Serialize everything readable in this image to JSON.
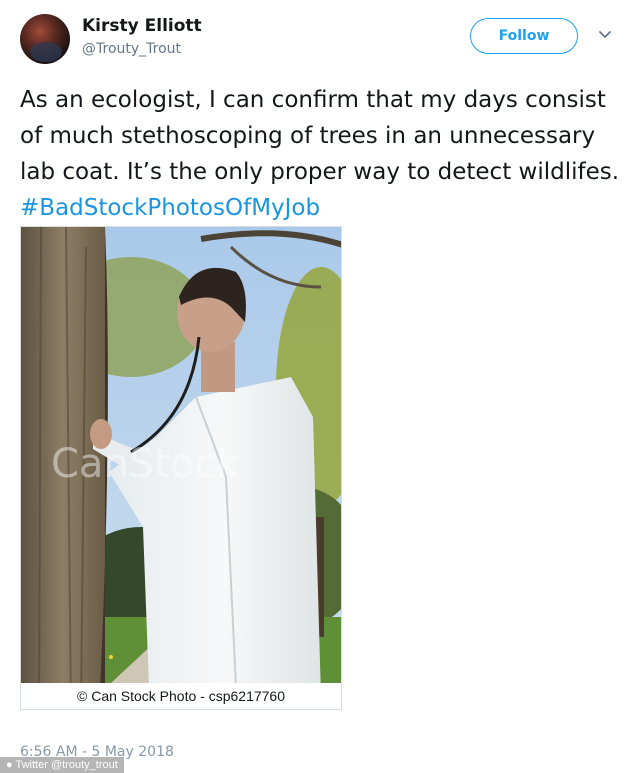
{
  "author": {
    "name": "Kirsty Elliott",
    "handle": "@Trouty_Trout"
  },
  "follow_label": "Follow",
  "tweet": {
    "text": "As an ecologist, I can confirm that my days consist of much stethoscoping of trees in an unnecessary lab coat. It’s the only proper way to detect wildlifes.",
    "hashtag": "#BadStockPhotosOfMyJob"
  },
  "photo": {
    "watermark": "CanStock",
    "caption": "© Can Stock Photo - csp6217760"
  },
  "timestamp": "6:56 AM - 5 May 2018",
  "credit": "● Twitter @trouty_trout",
  "colors": {
    "link": "#1b95e0",
    "follow_border": "#1da1f2",
    "meta_gray": "#657786"
  },
  "icons": [
    "avatar-image",
    "chevron-down-icon"
  ]
}
